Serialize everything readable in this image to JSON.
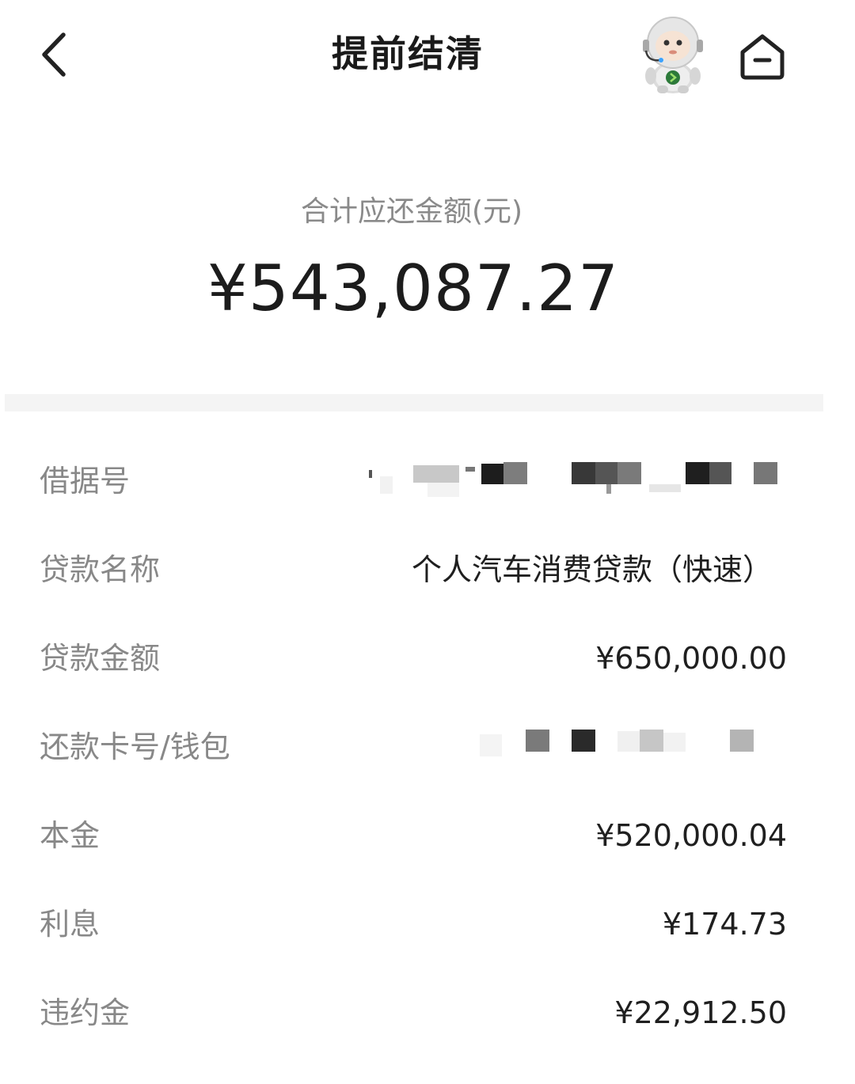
{
  "header": {
    "title": "提前结清",
    "back_icon": "chevron-left-icon",
    "mascot_icon": "robot-mascot-icon",
    "home_icon": "home-icon"
  },
  "summary": {
    "label": "合计应还金额(元)",
    "amount": "¥543,087.27"
  },
  "details": {
    "loan_ref": {
      "label": "借据号",
      "value_masked": true
    },
    "loan_name": {
      "label": "贷款名称",
      "value": "个人汽车消费贷款（快速）"
    },
    "loan_amount": {
      "label": "贷款金额",
      "value": "¥650,000.00"
    },
    "repay_card": {
      "label": "还款卡号/钱包",
      "value_masked": true
    },
    "principal": {
      "label": "本金",
      "value": "¥520,000.04"
    },
    "interest": {
      "label": "利息",
      "value": "¥174.73"
    },
    "penalty": {
      "label": "违约金",
      "value": "¥22,912.50"
    }
  },
  "colors": {
    "label_gray": "#888888",
    "value_dark": "#1f1f1f",
    "divider": "#f4f4f4",
    "mascot_green": "#3a9a3a"
  }
}
